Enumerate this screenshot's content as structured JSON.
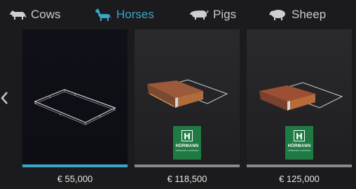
{
  "tabs": [
    {
      "label": "Cows",
      "icon": "cow-icon",
      "active": false
    },
    {
      "label": "Horses",
      "icon": "horse-icon",
      "active": true
    },
    {
      "label": "Pigs",
      "icon": "pig-icon",
      "active": false
    },
    {
      "label": "Sheep",
      "icon": "sheep-icon",
      "active": false
    }
  ],
  "cards": [
    {
      "price": "€ 55,000",
      "selected": true,
      "preview": "fenced-paddock"
    },
    {
      "price": "€ 118,500",
      "selected": false,
      "preview": "horse-barn-with-paddock",
      "brand": {
        "name": "HÖRMANN",
        "tagline": "HÖRMANN & FAMILIEN",
        "mark": "H"
      }
    },
    {
      "price": "€ 125,000",
      "selected": false,
      "preview": "horse-barn-with-paddock",
      "brand": {
        "name": "HÖRMANN",
        "tagline": "HÖRMANN & FAMILIEN",
        "mark": "H"
      }
    }
  ],
  "colors": {
    "accent": "#3aa6c8",
    "background": "#1b1b1d",
    "brand_green": "#1f7a43",
    "inactive_bar": "#8a8a8a"
  }
}
